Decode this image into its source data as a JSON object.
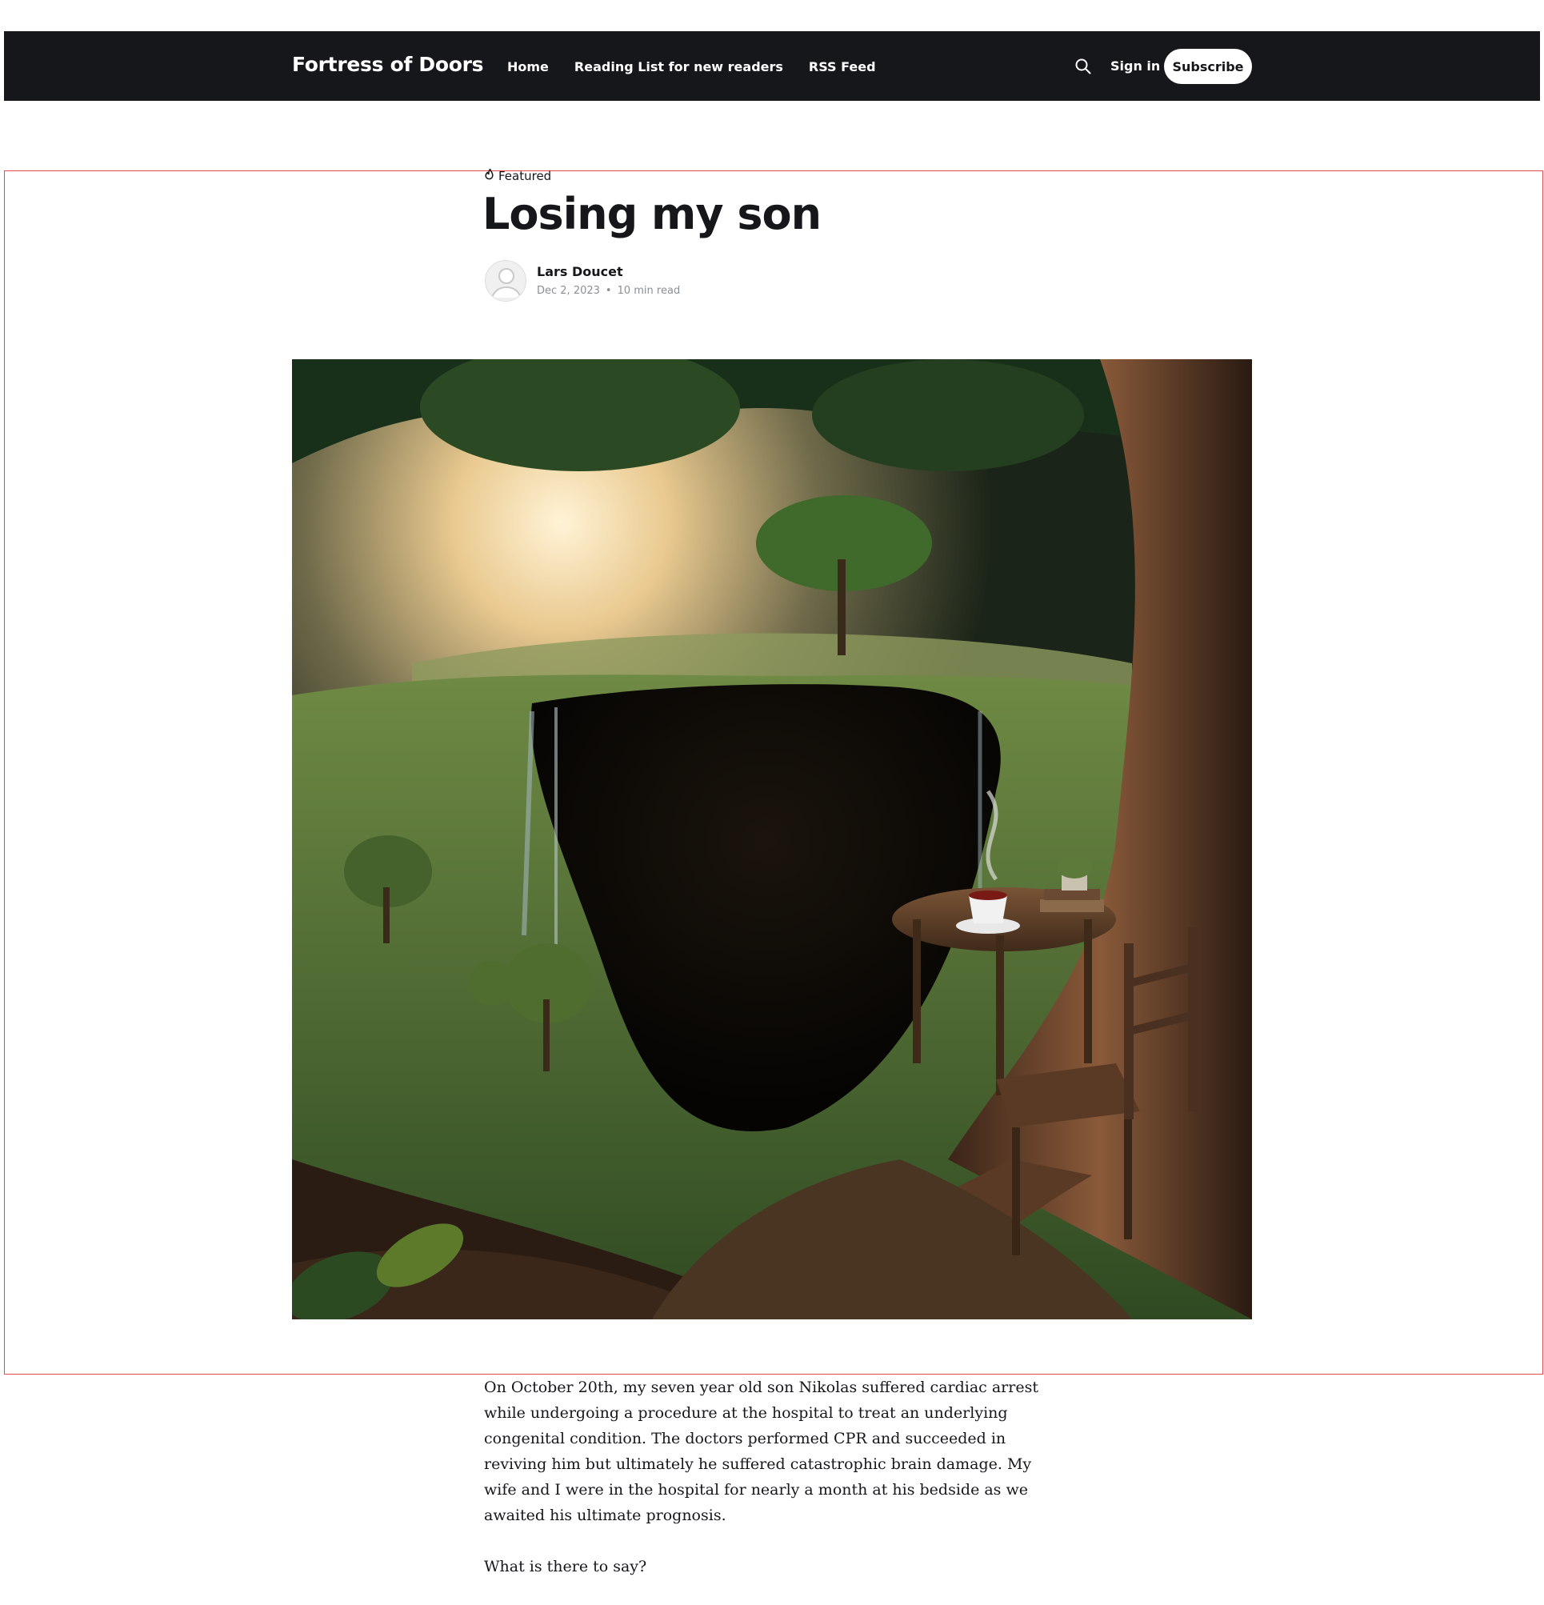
{
  "site": {
    "title": "Fortress of Doors"
  },
  "nav": {
    "items": [
      {
        "label": "Home"
      },
      {
        "label": "Reading List for new readers"
      },
      {
        "label": "RSS Feed"
      }
    ],
    "search_icon": "search-icon",
    "signin_label": "Sign in",
    "subscribe_label": "Subscribe"
  },
  "post": {
    "tag": "Featured",
    "tag_icon": "flame-icon",
    "title": "Losing my son",
    "author": "Lars Doucet",
    "date": "Dec 2, 2023",
    "separator": "•",
    "reading_time": "10 min read",
    "paragraphs": [
      "On October 20th, my seven year old son Nikolas suffered cardiac arrest while undergoing a procedure at the hospital to treat an underlying congenital condition. The doctors performed CPR and succeeded in reviving him but ultimately he suffered catastrophic brain damage. My wife and I were in the hospital for nearly a month at his bedside as we awaited his ultimate prognosis.",
      "What is there to say?"
    ]
  },
  "colors": {
    "nav_bg": "#15171a",
    "accent": "#ffffff",
    "text": "#15171a",
    "meta": "#8a8f96"
  }
}
